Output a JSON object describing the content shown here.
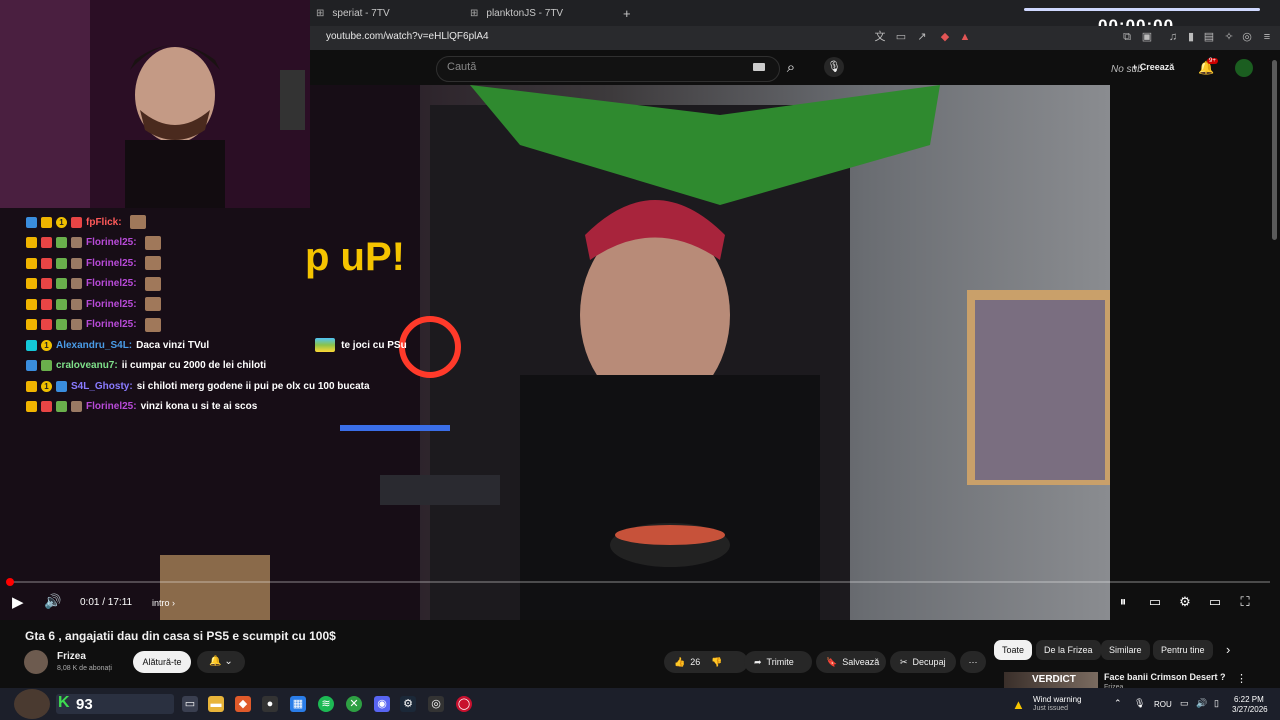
{
  "browser": {
    "tabs": [
      {
        "label": "speriat - 7TV"
      },
      {
        "label": "planktonJS - 7TV"
      }
    ],
    "new_tab": "+",
    "url": "youtube.com/watch?v=eHLlQF6plA4"
  },
  "overlay": {
    "timer": "00:00:00"
  },
  "youtube": {
    "search_placeholder": "Caută",
    "create_label": "Creează",
    "no_sub_label": "No sub",
    "notif_count": "9+"
  },
  "chat": {
    "messages": [
      {
        "user": "fpFlick:",
        "color": "#ff5a5a",
        "text": ""
      },
      {
        "user": "Florinel25:",
        "color": "#b84bd8",
        "text": ""
      },
      {
        "user": "Florinel25:",
        "color": "#b84bd8",
        "text": ""
      },
      {
        "user": "Florinel25:",
        "color": "#b84bd8",
        "text": ""
      },
      {
        "user": "Florinel25:",
        "color": "#b84bd8",
        "text": ""
      },
      {
        "user": "Florinel25:",
        "color": "#b84bd8",
        "text": ""
      },
      {
        "user": "Alexandru_S4L:",
        "color": "#4a9ce8",
        "text": "Daca vinzi TVul",
        "text2": "te joci cu PSu"
      },
      {
        "user": "craloveanu7:",
        "color": "#7fe08a",
        "text": "ii cumpar cu 2000 de lei chiloti"
      },
      {
        "user": "S4L_Ghosty:",
        "color": "#8a7bff",
        "text": "si chiloti merg godene ii pui pe olx cu 100 bucata"
      },
      {
        "user": "Florinel25:",
        "color": "#b84bd8",
        "text": "vinzi kona u si te ai scos"
      }
    ]
  },
  "player": {
    "current_time": "0:01 / 17:11",
    "chapter": "intro",
    "progress_fraction": 0.001
  },
  "video": {
    "title": "Gta 6 , angajatii dau din casa si PS5 e scumpit cu 100$",
    "channel": "Frizea",
    "subscribers": "8,08 K de abonați",
    "join_label": "Alătură-te",
    "likes": "26",
    "share_label": "Trimite",
    "save_label": "Salvează",
    "clip_label": "Decupaj",
    "more_label": "⋯"
  },
  "recommendations": {
    "chips": [
      "Toate",
      "De la Frizea",
      "Similare",
      "Pentru tine"
    ],
    "first_title": "Face banii Crimson Desert ?",
    "first_channel": "Frizea",
    "first_thumb_text": "VERDICT"
  },
  "taskbar": {
    "score": "93",
    "warning_title": "Wind warning",
    "warning_sub": "Just issued",
    "lang": "ROU",
    "time": "6:22 PM",
    "date": "3/27/2026"
  }
}
